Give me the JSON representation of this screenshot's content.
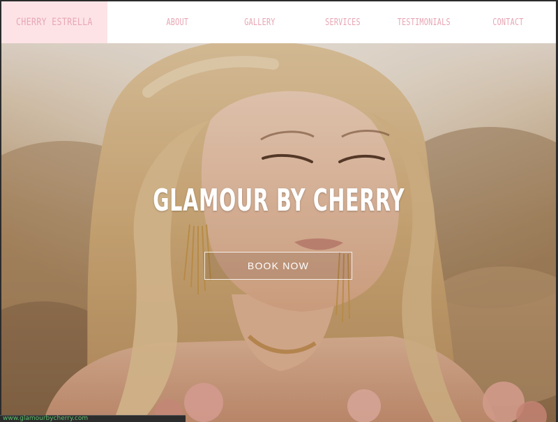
{
  "header": {
    "brand": "CHERRY ESTRELLA",
    "nav": [
      {
        "label": "ABOUT"
      },
      {
        "label": "GALLERY"
      },
      {
        "label": "SERVICES"
      },
      {
        "label": "TESTIMONIALS"
      },
      {
        "label": "CONTACT"
      }
    ]
  },
  "hero": {
    "title": "GLAMOUR BY CHERRY",
    "cta_label": "BOOK NOW"
  },
  "status_bar": {
    "url": "www.glamourbycherry.com"
  },
  "colors": {
    "brand_bg": "#fde3e6",
    "nav_text": "#e7a6b4",
    "header_bg": "#ffffff",
    "hero_text": "#ffffff"
  }
}
